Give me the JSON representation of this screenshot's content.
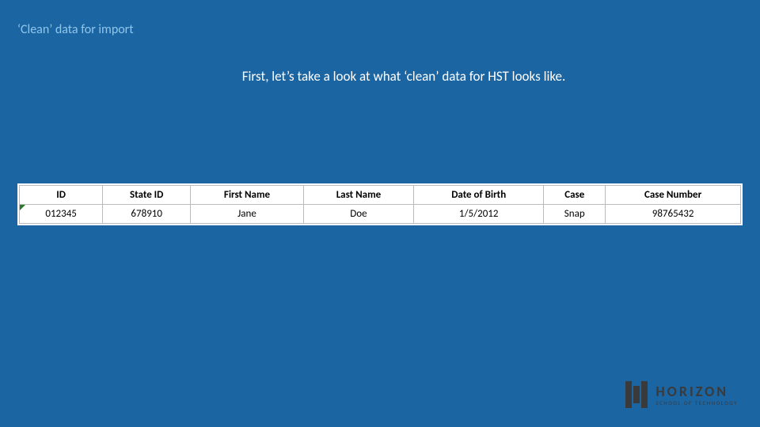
{
  "title": "‘Clean’ data for import",
  "subtitle": "First, let’s take a look at what ‘clean’ data for HST looks like.",
  "table": {
    "headers": [
      "ID",
      "State ID",
      "First Name",
      "Last Name",
      "Date of Birth",
      "Case",
      "Case Number"
    ],
    "row": [
      "012345",
      "678910",
      "Jane",
      "Doe",
      "1/5/2012",
      "Snap",
      "98765432"
    ]
  },
  "brand": {
    "name": "HORIZON",
    "tagline": "SCHOOL OF TECHNOLOGY"
  }
}
